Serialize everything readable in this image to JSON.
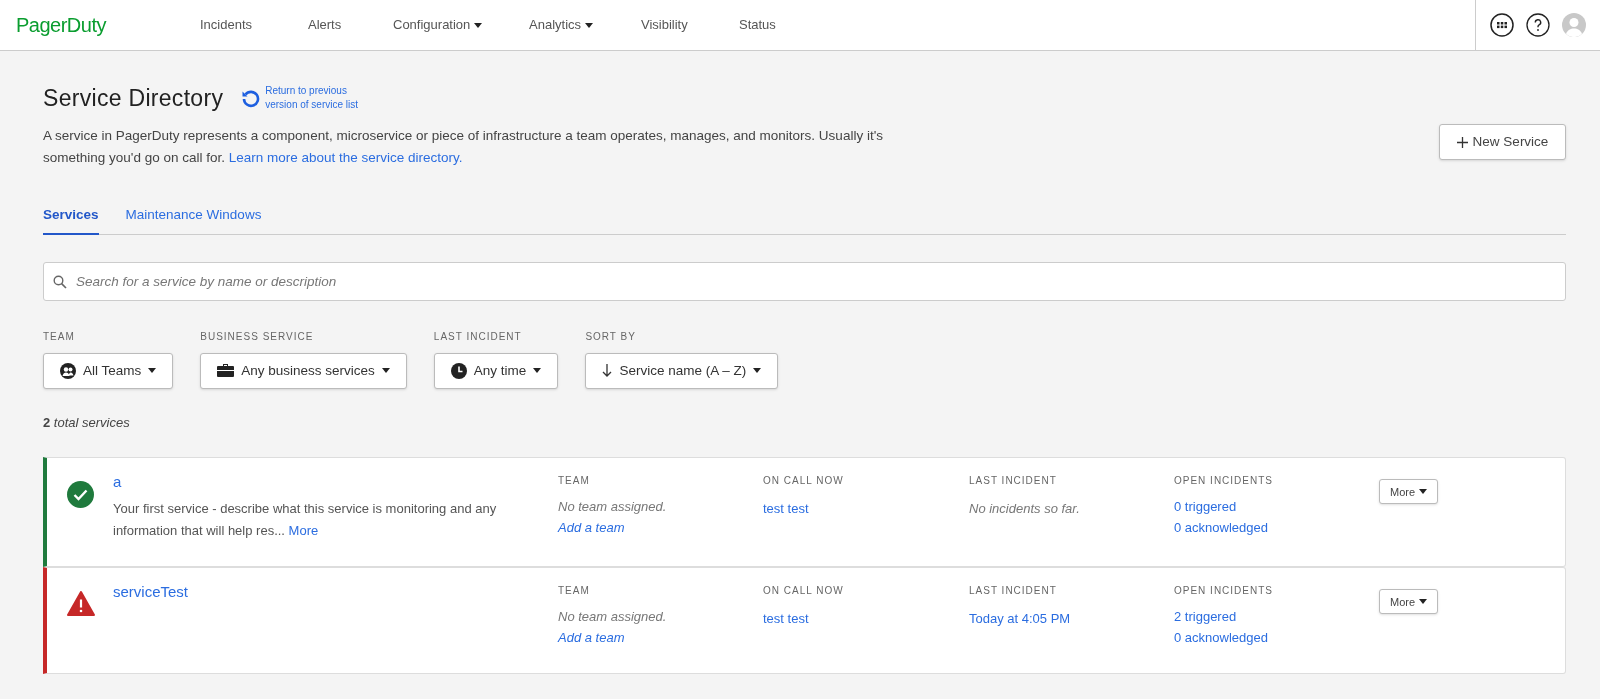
{
  "nav": {
    "logo": "PagerDuty",
    "items": [
      {
        "label": "Incidents",
        "dropdown": false
      },
      {
        "label": "Alerts",
        "dropdown": false
      },
      {
        "label": "Configuration",
        "dropdown": true
      },
      {
        "label": "Analytics",
        "dropdown": true
      },
      {
        "label": "Visibility",
        "dropdown": false
      },
      {
        "label": "Status",
        "dropdown": false
      }
    ]
  },
  "header": {
    "title": "Service Directory",
    "return_link": "Return to previous version of service list",
    "description": "A service in PagerDuty represents a component, microservice or piece of infrastructure a team operates, manages, and monitors. Usually it's something you'd go on call for.",
    "learn_link": "Learn more about the service directory.",
    "new_button": "New Service"
  },
  "tabs": [
    {
      "label": "Services",
      "selected": true
    },
    {
      "label": "Maintenance Windows",
      "selected": false
    }
  ],
  "search": {
    "placeholder": "Search for a service by name or description"
  },
  "filters": [
    {
      "label": "TEAM",
      "kind": "team",
      "value": "All Teams"
    },
    {
      "label": "BUSINESS SERVICE",
      "kind": "business",
      "value": "Any business services"
    },
    {
      "label": "LAST INCIDENT",
      "kind": "time",
      "value": "Any time"
    },
    {
      "label": "SORT BY",
      "kind": "sort",
      "value": "Service name (A – Z)"
    }
  ],
  "total": "**2** *total services*",
  "services": [
    {
      "kind": "ok",
      "name": "a",
      "description": "Your first service - describe what this service is monitoring and any information that will help res...",
      "more_link": "More",
      "team_label": "TEAM",
      "team_text": "No team assigned.",
      "team_link": "Add a team",
      "oncall_label": "ON CALL NOW",
      "oncall": "test test",
      "last_incident": {
        "label": "LAST INCIDENT",
        "kind": "none",
        "text": "No incidents so far."
      },
      "open_label": "OPEN INCIDENTS",
      "triggered": "0 triggered",
      "acknowledged": "0 acknowledged",
      "more_button": "More"
    },
    {
      "kind": "critical",
      "name": "serviceTest",
      "team_label": "TEAM",
      "team_text": "No team assigned.",
      "team_link": "Add a team",
      "oncall_label": "ON CALL NOW",
      "oncall": "test test",
      "last_incident": {
        "label": "LAST INCIDENT",
        "kind": "link",
        "text": "Today at 4:05 PM"
      },
      "open_label": "OPEN INCIDENTS",
      "triggered": "2 triggered",
      "acknowledged": "0 acknowledged",
      "more_button": "More"
    }
  ]
}
